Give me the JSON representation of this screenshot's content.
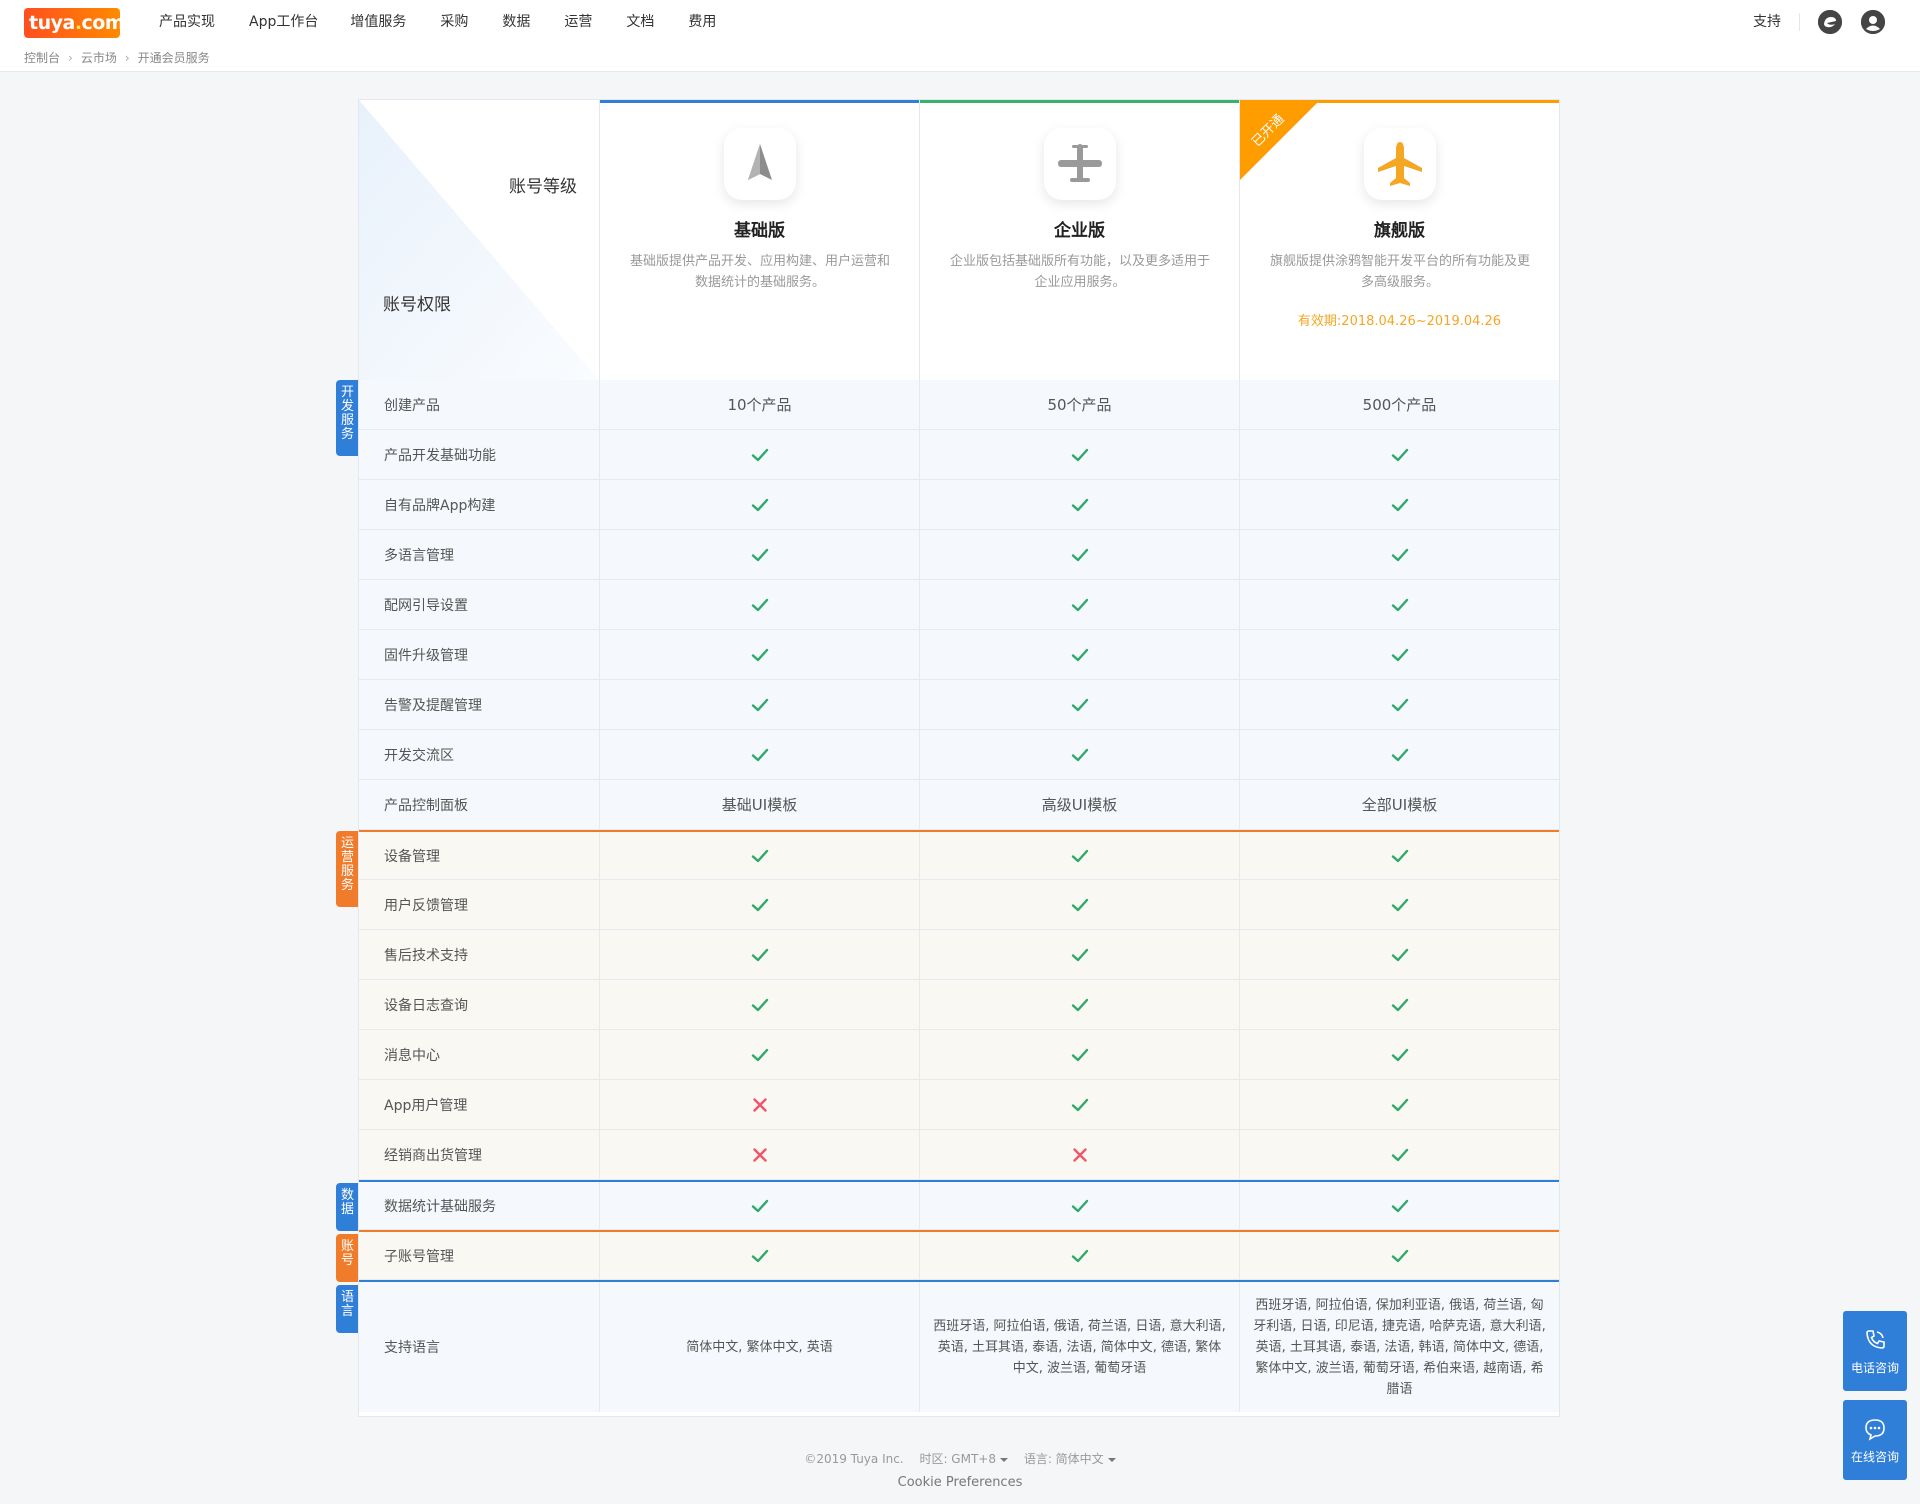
{
  "topbar": {
    "logo": {
      "text": "tuya",
      "dot": ".",
      "suffix": "com"
    },
    "nav": [
      "产品实现",
      "App工作台",
      "增值服务",
      "采购",
      "数据",
      "运营",
      "文档",
      "费用"
    ],
    "support": "支持",
    "icons": [
      "message-icon",
      "user-avatar-icon"
    ]
  },
  "breadcrumb": [
    "控制台",
    "云市场",
    "开通会员服务"
  ],
  "corner": {
    "top_label": "账号等级",
    "bottom_label": "账号权限"
  },
  "plans": [
    {
      "name": "基础版",
      "icon": "paper-plane-icon",
      "accent": "#2f7ed8",
      "desc": "基础版提供产品开发、应用构建、用户运营和数据统计的基础服务。",
      "validity": ""
    },
    {
      "name": "企业版",
      "icon": "propeller-plane-icon",
      "accent": "#38b36b",
      "desc": "企业版包括基础版所有功能，以及更多适用于企业应用服务。",
      "validity": ""
    },
    {
      "name": "旗舰版",
      "icon": "jet-plane-icon",
      "accent": "#ff9c00",
      "desc": "旗舰版提供涂鸦智能开发平台的所有功能及更多高级服务。",
      "validity": "有效期:2018.04.26~2019.04.26",
      "ribbon": "已开通"
    }
  ],
  "sections": [
    {
      "label": "开发服务",
      "color": "#2f7ed8"
    },
    {
      "label": "运营服务",
      "color": "#f07b2b"
    },
    {
      "label": "数据",
      "color": "#2f7ed8"
    },
    {
      "label": "账号",
      "color": "#f07b2b"
    },
    {
      "label": "语言",
      "color": "#2f7ed8"
    }
  ],
  "rows": [
    {
      "section": 0,
      "label": "创建产品",
      "values": [
        "10个产品",
        "50个产品",
        "500个产品"
      ]
    },
    {
      "section": 0,
      "label": "产品开发基础功能",
      "values": [
        "check",
        "check",
        "check"
      ]
    },
    {
      "section": 0,
      "label": "自有品牌App构建",
      "values": [
        "check",
        "check",
        "check"
      ]
    },
    {
      "section": 0,
      "label": "多语言管理",
      "values": [
        "check",
        "check",
        "check"
      ]
    },
    {
      "section": 0,
      "label": "配网引导设置",
      "values": [
        "check",
        "check",
        "check"
      ]
    },
    {
      "section": 0,
      "label": "固件升级管理",
      "values": [
        "check",
        "check",
        "check"
      ]
    },
    {
      "section": 0,
      "label": "告警及提醒管理",
      "values": [
        "check",
        "check",
        "check"
      ]
    },
    {
      "section": 0,
      "label": "开发交流区",
      "values": [
        "check",
        "check",
        "check"
      ]
    },
    {
      "section": 0,
      "label": "产品控制面板",
      "values": [
        "基础UI模板",
        "高级UI模板",
        "全部UI模板"
      ]
    },
    {
      "section": 1,
      "label": "设备管理",
      "values": [
        "check",
        "check",
        "check"
      ]
    },
    {
      "section": 1,
      "label": "用户反馈管理",
      "values": [
        "check",
        "check",
        "check"
      ]
    },
    {
      "section": 1,
      "label": "售后技术支持",
      "values": [
        "check",
        "check",
        "check"
      ]
    },
    {
      "section": 1,
      "label": "设备日志查询",
      "values": [
        "check",
        "check",
        "check"
      ]
    },
    {
      "section": 1,
      "label": "消息中心",
      "values": [
        "check",
        "check",
        "check"
      ]
    },
    {
      "section": 1,
      "label": "App用户管理",
      "values": [
        "cross",
        "check",
        "check"
      ]
    },
    {
      "section": 1,
      "label": "经销商出货管理",
      "values": [
        "cross",
        "cross",
        "check"
      ]
    },
    {
      "section": 2,
      "label": "数据统计基础服务",
      "values": [
        "check",
        "check",
        "check"
      ]
    },
    {
      "section": 3,
      "label": "子账号管理",
      "values": [
        "check",
        "check",
        "check"
      ]
    },
    {
      "section": 4,
      "label": "支持语言",
      "values": [
        "简体中文, 繁体中文, 英语",
        "西班牙语, 阿拉伯语, 俄语, 荷兰语, 日语, 意大利语, 英语, 土耳其语, 泰语, 法语, 简体中文, 德语, 繁体中文, 波兰语, 葡萄牙语",
        "西班牙语, 阿拉伯语, 保加利亚语, 俄语, 荷兰语, 匈牙利语, 日语, 印尼语, 捷克语, 哈萨克语, 意大利语, 英语, 土耳其语, 泰语, 法语, 韩语, 简体中文, 德语, 繁体中文, 波兰语, 葡萄牙语, 希伯来语, 越南语, 希腊语"
      ]
    }
  ],
  "status_colors": {
    "check": "#2fa86a",
    "cross": "#f0566b"
  },
  "footer": {
    "copyright": "©2019 Tuya Inc.",
    "timezone": "时区: GMT+8",
    "language": "语言: 简体中文",
    "cookie": "Cookie Preferences"
  },
  "help": [
    {
      "label": "电话咨询",
      "icon": "phone-icon"
    },
    {
      "label": "在线咨询",
      "icon": "chat-icon"
    }
  ]
}
